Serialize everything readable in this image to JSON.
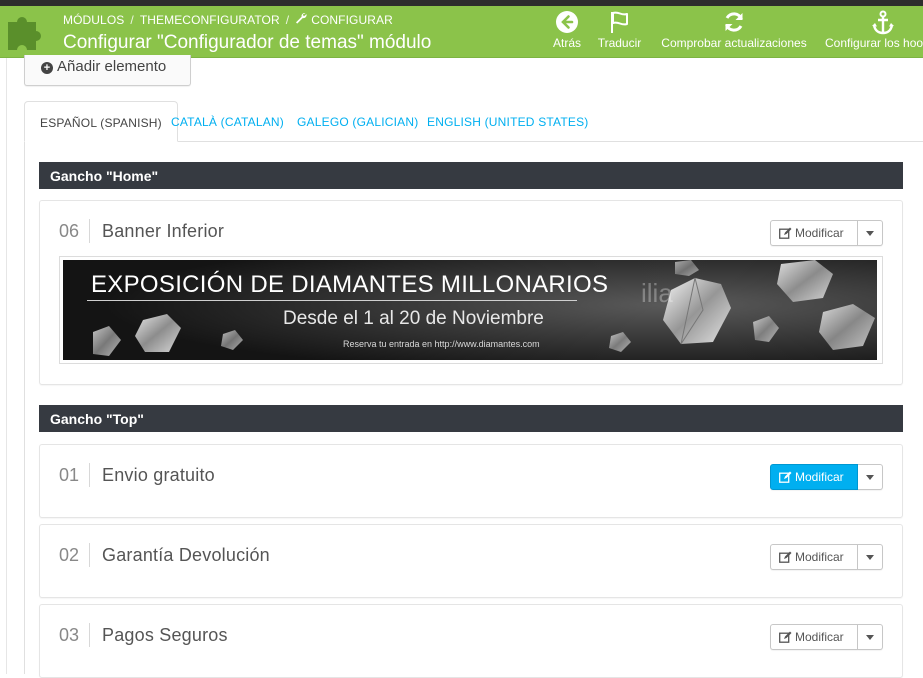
{
  "header": {
    "breadcrumb": [
      "MÓDULOS",
      "THEMECONFIGURATOR",
      "CONFIGURAR"
    ],
    "separators": [
      "/",
      "/"
    ],
    "title": "Configurar \"Configurador de temas\" módulo",
    "toolbar": [
      {
        "label": "Atrás",
        "icon": "arrow-left-circle-icon"
      },
      {
        "label": "Traducir",
        "icon": "flag-icon"
      },
      {
        "label": "Comprobar actualizaciones",
        "icon": "refresh-icon"
      },
      {
        "label": "Configurar los hooks",
        "icon": "anchor-icon"
      }
    ],
    "colors": {
      "bar": "#8bc34a",
      "dark": "#2d2d2d"
    }
  },
  "add_element_label": "Añadir elemento",
  "languages": [
    {
      "label": "ESPAÑOL (SPANISH)",
      "active": true
    },
    {
      "label": "CATALÀ (CATALAN)",
      "active": false
    },
    {
      "label": "GALEGO (GALICIAN)",
      "active": false
    },
    {
      "label": "ENGLISH (UNITED STATES)",
      "active": false
    }
  ],
  "hooks": [
    {
      "title": "Gancho \"Home\"",
      "items": [
        {
          "number": "06",
          "title": "Banner Inferior",
          "button": "Modificar",
          "banner": {
            "line1": "EXPOSICIÓN DE DIAMANTES MILLONARIOS",
            "line2": "Desde el 1 al 20  de Noviembre",
            "line3": "Reserva tu entrada en http://www.diamantes.com",
            "watermark": "ilia"
          }
        }
      ]
    },
    {
      "title": "Gancho \"Top\"",
      "items": [
        {
          "number": "01",
          "title": "Envio gratuito",
          "button": "Modificar",
          "highlighted": true
        },
        {
          "number": "02",
          "title": "Garantía Devolución",
          "button": "Modificar"
        },
        {
          "number": "03",
          "title": "Pagos Seguros",
          "button": "Modificar"
        }
      ]
    }
  ],
  "accent_color": "#00aff0"
}
